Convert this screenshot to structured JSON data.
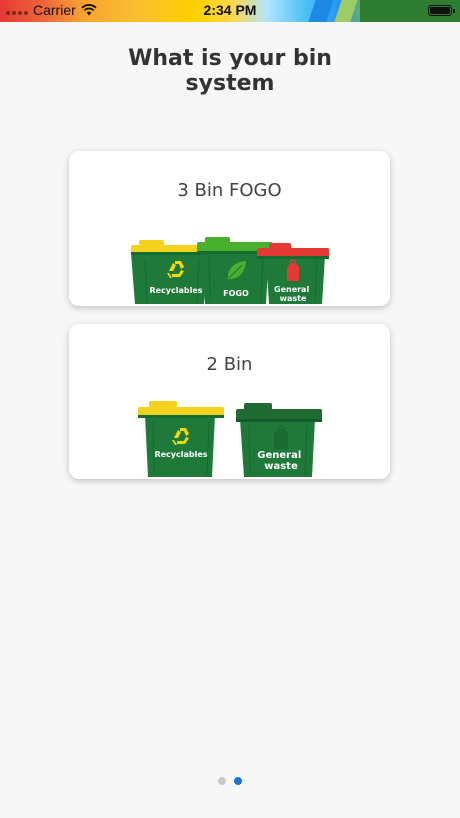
{
  "status_bar": {
    "carrier": "Carrier",
    "time": "2:34 PM"
  },
  "title": {
    "line1": "What is your bin",
    "line2": "system"
  },
  "options": [
    {
      "label": "3 Bin FOGO",
      "bins": [
        {
          "lid_color": "#f2d21a",
          "label": "Recyclables",
          "icon": "recycle-icon"
        },
        {
          "lid_color": "#49b02e",
          "label": "FOGO",
          "icon": "leaf-icon"
        },
        {
          "lid_color": "#e53935",
          "label": "General waste",
          "icon": "bag-icon"
        }
      ]
    },
    {
      "label": "2 Bin",
      "bins": [
        {
          "lid_color": "#f2d21a",
          "label": "Recyclables",
          "icon": "recycle-icon"
        },
        {
          "lid_color": "#1f6b33",
          "label": "General waste",
          "icon": "bag-icon"
        }
      ]
    }
  ],
  "colors": {
    "bin_body": "#1f7a3a",
    "bin_body_dark": "#166030",
    "recycle_symbol": "#f5d90a",
    "active_dot": "#1976d2",
    "inactive_dot": "#c8c8c8"
  },
  "pagination": {
    "count": 2,
    "active_index": 1
  }
}
